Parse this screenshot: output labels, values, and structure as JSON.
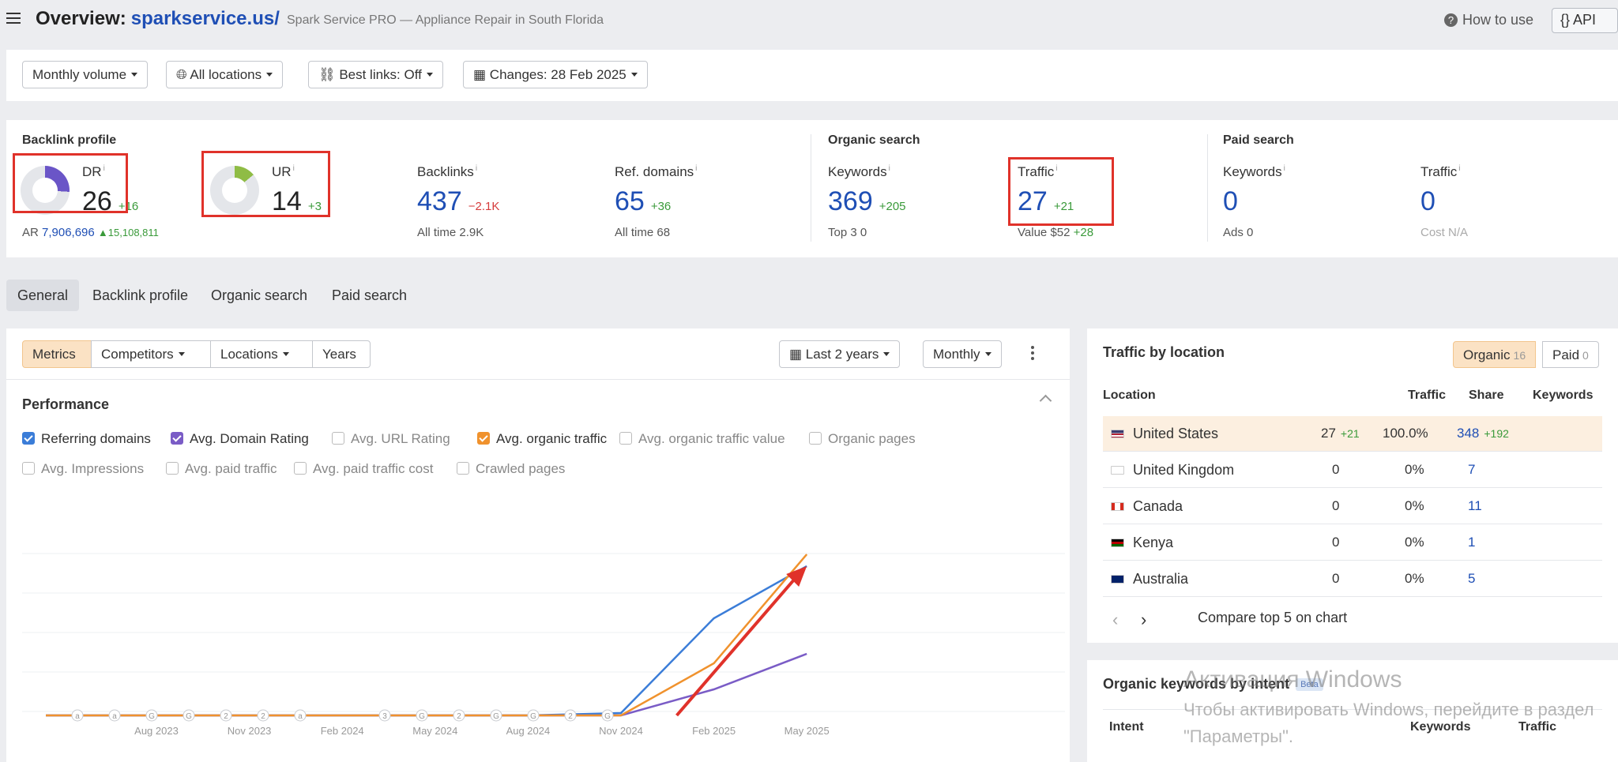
{
  "header": {
    "title": "Overview:",
    "domain": "sparkservice.us/",
    "subtitle": "Spark Service PRO — Appliance Repair in South Florida",
    "how_to": "How to use",
    "api": "{} API"
  },
  "filters": {
    "volume": "Monthly volume",
    "locations": "All locations",
    "best_links": "Best links: Off",
    "changes": "Changes: 28 Feb 2025"
  },
  "metrics": {
    "backlink_profile": "Backlink profile",
    "organic_search": "Organic search",
    "paid_search": "Paid search",
    "dr": {
      "label": "DR",
      "value": "26",
      "delta": "+16",
      "donut_fraction": 0.26
    },
    "ar": {
      "label": "AR",
      "value": "7,906,696",
      "delta": "▲15,108,811"
    },
    "ur": {
      "label": "UR",
      "value": "14",
      "delta": "+3",
      "donut_fraction": 0.14
    },
    "backlinks": {
      "label": "Backlinks",
      "value": "437",
      "delta": "−2.1K",
      "sub_label": "All time",
      "sub_value": "2.9K"
    },
    "ref_domains": {
      "label": "Ref. domains",
      "value": "65",
      "delta": "+36",
      "sub_label": "All time",
      "sub_value": "68"
    },
    "org_keywords": {
      "label": "Keywords",
      "value": "369",
      "delta": "+205",
      "sub_label": "Top 3",
      "sub_value": "0"
    },
    "org_traffic": {
      "label": "Traffic",
      "value": "27",
      "delta": "+21",
      "sub_label": "Value",
      "sub_value": "$52",
      "sub_delta": "+28"
    },
    "paid_keywords": {
      "label": "Keywords",
      "value": "0",
      "sub_label": "Ads",
      "sub_value": "0"
    },
    "paid_traffic": {
      "label": "Traffic",
      "value": "0",
      "sub_label": "Cost",
      "sub_value": "N/A"
    }
  },
  "tabs": [
    "General",
    "Backlink profile",
    "Organic search",
    "Paid search"
  ],
  "chart_controls": {
    "segments": [
      "Metrics",
      "Competitors",
      "Locations",
      "Years"
    ],
    "period": "Last 2 years",
    "granularity": "Monthly"
  },
  "performance": {
    "title": "Performance",
    "checkboxes": [
      {
        "label": "Referring domains",
        "checked": true,
        "color": "#3b7dd8"
      },
      {
        "label": "Avg. Domain Rating",
        "checked": true,
        "color": "#7a5cc6"
      },
      {
        "label": "Avg. URL Rating",
        "checked": false
      },
      {
        "label": "Avg. organic traffic",
        "checked": true,
        "color": "#f0922d"
      },
      {
        "label": "Avg. organic traffic value",
        "checked": false
      },
      {
        "label": "Organic pages",
        "checked": false
      },
      {
        "label": "Avg. Impressions",
        "checked": false
      },
      {
        "label": "Avg. paid traffic",
        "checked": false
      },
      {
        "label": "Avg. paid traffic cost",
        "checked": false
      },
      {
        "label": "Crawled pages",
        "checked": false
      }
    ]
  },
  "chart_data": {
    "type": "line",
    "x": [
      "Aug 2023",
      "Nov 2023",
      "Feb 2024",
      "May 2024",
      "Aug 2024",
      "Nov 2024",
      "Feb 2025",
      "May 2025"
    ],
    "series": [
      {
        "name": "Referring domains",
        "color": "#3b7dd8",
        "values": [
          0,
          0,
          0,
          0,
          0,
          1,
          41,
          63
        ]
      },
      {
        "name": "Avg. Domain Rating",
        "color": "#7a5cc6",
        "values": [
          0,
          0,
          0,
          0,
          0,
          0,
          11,
          26
        ]
      },
      {
        "name": "Avg. organic traffic",
        "color": "#f0922d",
        "values": [
          0,
          0,
          0,
          0,
          0,
          0,
          22,
          68
        ]
      }
    ],
    "annotation_markers": [
      "a",
      "a",
      "G",
      "G",
      "2",
      "2",
      "a",
      "3",
      "G",
      "2",
      "G",
      "G",
      "2",
      "G"
    ],
    "grid": true
  },
  "traffic_by_location": {
    "title": "Traffic by location",
    "organic_label": "Organic",
    "organic_count": "16",
    "paid_label": "Paid",
    "paid_count": "0",
    "columns": [
      "Location",
      "Traffic",
      "Share",
      "Keywords"
    ],
    "rows": [
      {
        "country": "United States",
        "flag": "us",
        "traffic": "27",
        "traffic_delta": "+21",
        "share": "100.0%",
        "keywords": "348",
        "keywords_delta": "+192"
      },
      {
        "country": "United Kingdom",
        "flag": "gb",
        "traffic": "0",
        "share": "0%",
        "keywords": "7"
      },
      {
        "country": "Canada",
        "flag": "ca",
        "traffic": "0",
        "share": "0%",
        "keywords": "11"
      },
      {
        "country": "Kenya",
        "flag": "ke",
        "traffic": "0",
        "share": "0%",
        "keywords": "1"
      },
      {
        "country": "Australia",
        "flag": "au",
        "traffic": "0",
        "share": "0%",
        "keywords": "5"
      }
    ],
    "compare": "Compare top 5 on chart"
  },
  "intent": {
    "title": "Organic keywords by intent",
    "badge": "Beta",
    "columns": [
      "Intent",
      "Keywords",
      "Traffic"
    ]
  },
  "watermark": {
    "line1": "Активация Windows",
    "line2": "Чтобы активировать Windows, перейдите в раздел",
    "line3": "\"Параметры\"."
  }
}
